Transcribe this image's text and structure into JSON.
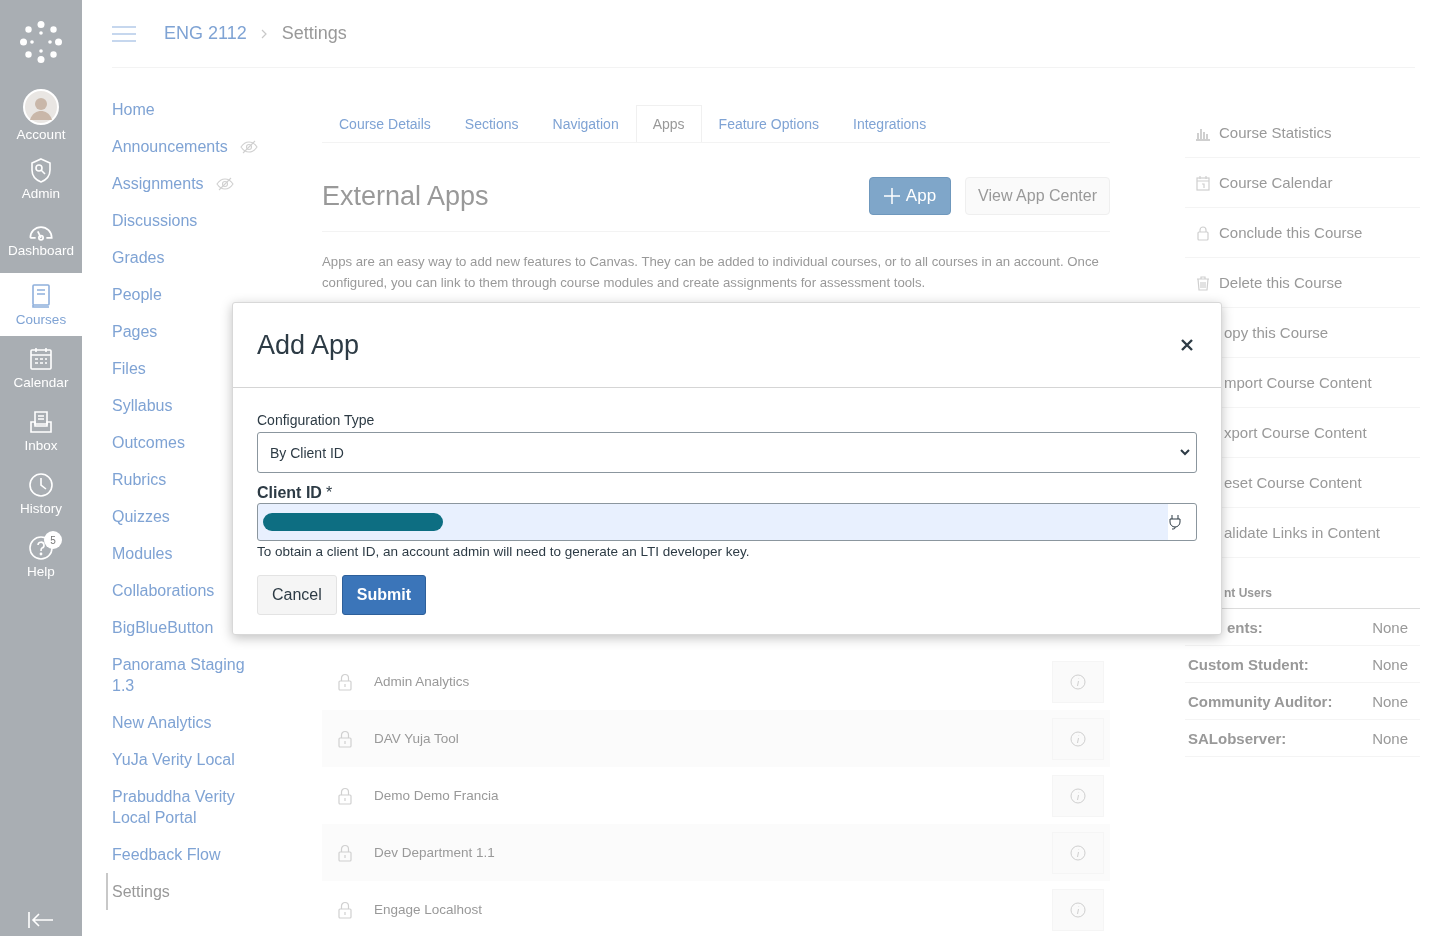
{
  "global_nav": {
    "items": [
      {
        "label": "Account",
        "kind": "avatar",
        "selected": false
      },
      {
        "label": "Admin",
        "kind": "shield",
        "selected": false
      },
      {
        "label": "Dashboard",
        "kind": "gauge",
        "selected": false
      },
      {
        "label": "Courses",
        "kind": "book",
        "selected": true
      },
      {
        "label": "Calendar",
        "kind": "calendar",
        "selected": false
      },
      {
        "label": "Inbox",
        "kind": "inbox",
        "selected": false
      },
      {
        "label": "History",
        "kind": "clock",
        "selected": false
      },
      {
        "label": "Help",
        "kind": "help",
        "selected": false,
        "badge": "5"
      }
    ]
  },
  "breadcrumbs": [
    {
      "label": "ENG 2112",
      "kind": "link"
    },
    {
      "label": "Settings",
      "kind": "current"
    }
  ],
  "course_nav": [
    {
      "label": "Home",
      "hidden": false,
      "selected": false
    },
    {
      "label": "Announcements",
      "hidden": true,
      "selected": false
    },
    {
      "label": "Assignments",
      "hidden": true,
      "selected": false
    },
    {
      "label": "Discussions",
      "hidden": false,
      "selected": false
    },
    {
      "label": "Grades",
      "hidden": false,
      "selected": false
    },
    {
      "label": "People",
      "hidden": false,
      "selected": false
    },
    {
      "label": "Pages",
      "hidden": false,
      "selected": false
    },
    {
      "label": "Files",
      "hidden": false,
      "selected": false
    },
    {
      "label": "Syllabus",
      "hidden": false,
      "selected": false
    },
    {
      "label": "Outcomes",
      "hidden": false,
      "selected": false
    },
    {
      "label": "Rubrics",
      "hidden": false,
      "selected": false
    },
    {
      "label": "Quizzes",
      "hidden": false,
      "selected": false
    },
    {
      "label": "Modules",
      "hidden": false,
      "selected": false
    },
    {
      "label": "Collaborations",
      "hidden": false,
      "selected": false
    },
    {
      "label": "BigBlueButton",
      "hidden": false,
      "selected": false
    },
    {
      "label": "Panorama Staging 1.3",
      "hidden": false,
      "selected": false
    },
    {
      "label": "New Analytics",
      "hidden": false,
      "selected": false
    },
    {
      "label": "YuJa Verity Local",
      "hidden": false,
      "selected": false
    },
    {
      "label": "Prabuddha Verity Local Portal",
      "hidden": false,
      "selected": false
    },
    {
      "label": "Feedback Flow",
      "hidden": false,
      "selected": false
    },
    {
      "label": "Settings",
      "hidden": false,
      "selected": true
    }
  ],
  "tabs": [
    {
      "label": "Course Details",
      "selected": false
    },
    {
      "label": "Sections",
      "selected": false
    },
    {
      "label": "Navigation",
      "selected": false
    },
    {
      "label": "Apps",
      "selected": true
    },
    {
      "label": "Feature Options",
      "selected": false
    },
    {
      "label": "Integrations",
      "selected": false
    }
  ],
  "page_title": "External Apps",
  "buttons": [
    {
      "label": "App",
      "kind": "add"
    },
    {
      "label": "View App Center",
      "kind": "plain"
    }
  ],
  "description": "Apps are an easy way to add new features to Canvas. They can be added to individual courses, or to all courses in an account. Once configured, you can link to them through course modules and create assignments for assessment tools.",
  "apps": [
    {
      "name": "Admin Analytics"
    },
    {
      "name": "DAV Yuja Tool"
    },
    {
      "name": "Demo Demo Francia"
    },
    {
      "name": "Dev Department 1.1"
    },
    {
      "name": "Engage Localhost"
    }
  ],
  "sidebar": {
    "actions": [
      {
        "label": "Course Statistics",
        "kind": "stats"
      },
      {
        "label": "Course Calendar",
        "kind": "calendar"
      },
      {
        "label": "Conclude this Course",
        "kind": "lock"
      },
      {
        "label": "Delete this Course",
        "kind": "trash"
      },
      {
        "label": "opy this Course",
        "kind": "covered"
      },
      {
        "label": "mport Course Content",
        "kind": "covered"
      },
      {
        "label": "xport Course Content",
        "kind": "covered"
      },
      {
        "label": "eset Course Content",
        "kind": "covered"
      },
      {
        "label": "alidate Links in Content",
        "kind": "covered"
      }
    ],
    "users_heading": {
      "text": "nt Users",
      "clipped": true
    },
    "users": [
      {
        "role": "ents:",
        "count": "None",
        "clipped": true
      },
      {
        "role": "Custom Student:",
        "count": "None",
        "clipped": false
      },
      {
        "role": "Community Auditor:",
        "count": "None",
        "clipped": false
      },
      {
        "role": "SALobserver:",
        "count": "None",
        "clipped": false
      }
    ]
  },
  "modal": {
    "title": "Add App",
    "config_label": "Configuration Type",
    "config_value": "By Client ID",
    "client_id_label": "Client ID",
    "required_mark": "*",
    "help": "To obtain a client ID, an account admin will need to generate an LTI developer key.",
    "buttons": [
      {
        "label": "Cancel",
        "kind": "secondary"
      },
      {
        "label": "Submit",
        "kind": "primary"
      }
    ]
  }
}
